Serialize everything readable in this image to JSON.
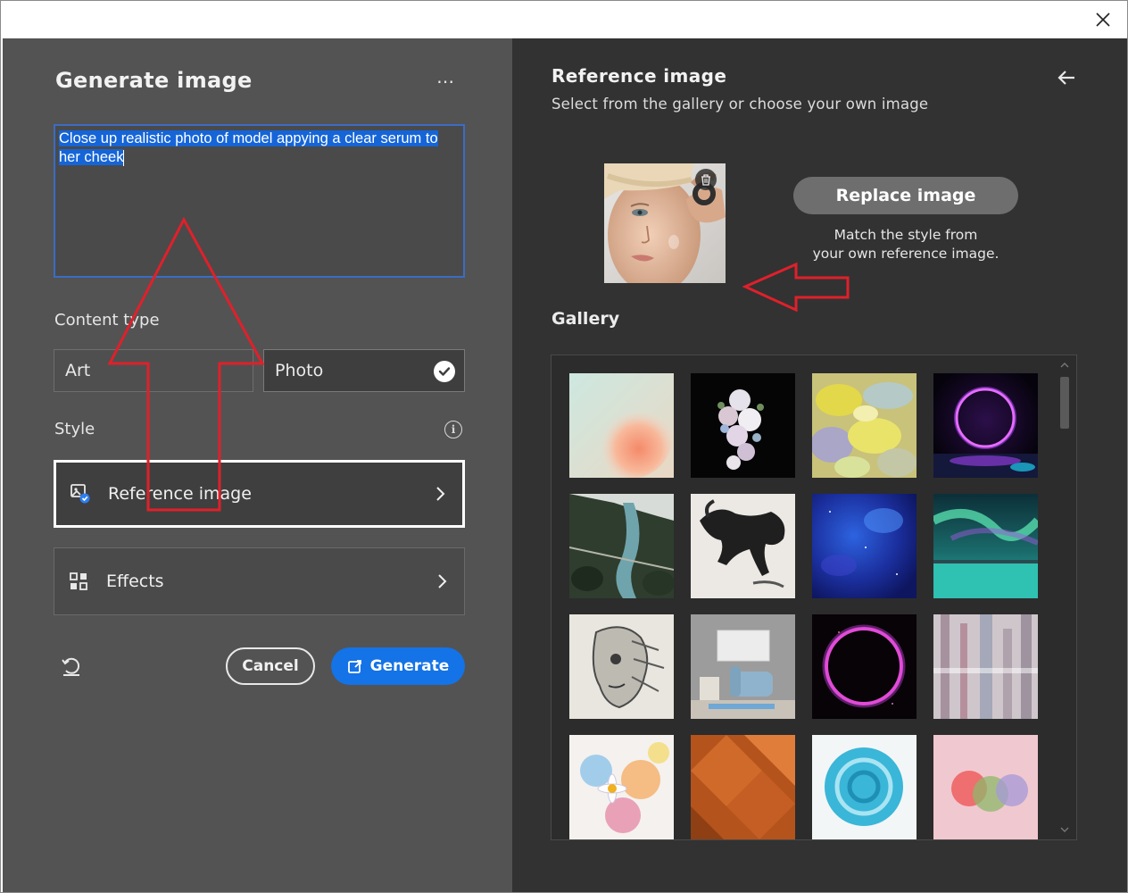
{
  "left": {
    "title": "Generate image",
    "more_label": "⋯",
    "prompt_text_line1": "Close up realistic photo of model appying a clear serum to",
    "prompt_text_line2": "her cheek",
    "content_type_label": "Content type",
    "content_options": [
      "Art",
      "Photo"
    ],
    "selected_content": "Photo",
    "style_label": "Style",
    "reference_label": "Reference image",
    "effects_label": "Effects",
    "cancel_label": "Cancel",
    "generate_label": "Generate"
  },
  "right": {
    "title": "Reference image",
    "subtitle": "Select from the gallery or choose your own image",
    "replace_label": "Replace image",
    "match_line1": "Match the style from",
    "match_line2": "your own reference image.",
    "gallery_title": "Gallery",
    "gallery_tiles": [
      "pastel-gradient-orb",
      "white-flower-bouquet",
      "yellow-paint-texture",
      "purple-neon-ring",
      "aerial-river-canyon",
      "ink-horse-painting",
      "blue-space-texture",
      "aurora-over-lake",
      "robot-face-sketch",
      "grey-room-blue-chair",
      "pink-neon-circle",
      "abstract-city-blur",
      "watercolor-daisies",
      "orange-geometric-squares",
      "blue-paint-swirl",
      "colorful-spheres-pink"
    ]
  },
  "colors": {
    "left_panel": "#535353",
    "right_panel": "#323232",
    "accent": "#1473e6",
    "annotation": "#e0202a"
  }
}
